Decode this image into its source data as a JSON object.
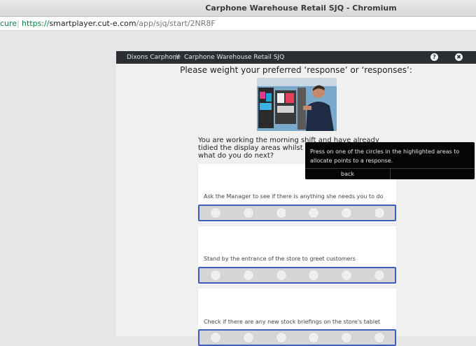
{
  "window": {
    "title": "Carphone Warehouse Retail SJQ - Chromium"
  },
  "address": {
    "secure_label": "cure",
    "scheme": "https://",
    "host": "smartplayer.cut-e.com",
    "path": "/app/sjq/start/2NR8F"
  },
  "header": {
    "crumb1": "Dixons Carphone",
    "separator": "//",
    "crumb2": "Carphone Warehouse Retail SJQ",
    "help_glyph": "?",
    "close_glyph": "✖"
  },
  "main": {
    "instruction": "Please weight your preferred ‘response’ or ‘responses’:",
    "question": "You are working the morning shift and have already tidied the display areas whilst you wait for cus office, what do you do next?",
    "responses": [
      {
        "label": "Ask the Manager to see if there is anything she needs you to do"
      },
      {
        "label": "Stand by the entrance of the store to greet customers"
      },
      {
        "label": "Check if there are any new stock briefings on the store's tablet"
      }
    ]
  },
  "tooltip": {
    "message": "Press on one of the circles in the highlighted areas to allocate points to a response.",
    "back_label": "back"
  },
  "colors": {
    "header_bg": "#2b2f33",
    "highlight_border": "#3f5dbf",
    "secure_green": "#0b8043",
    "tooltip_bg": "#050505"
  }
}
